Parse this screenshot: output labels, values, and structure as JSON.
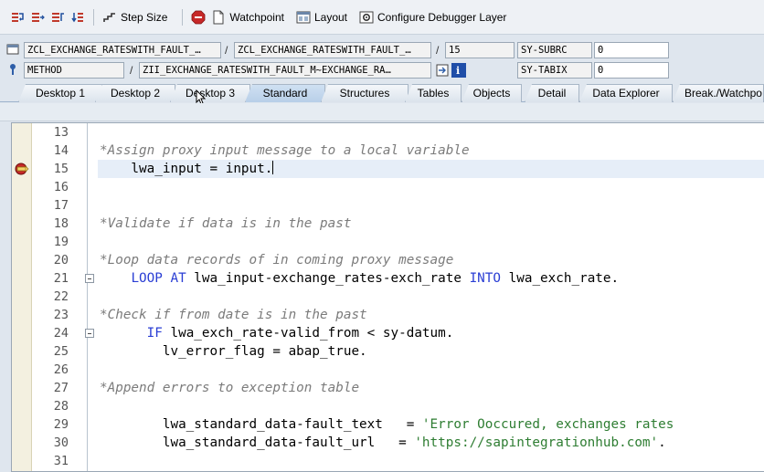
{
  "toolbar": {
    "step_size_label": "Step Size",
    "watchpoint_label": "Watchpoint",
    "layout_label": "Layout",
    "configure_label": "Configure Debugger Layer"
  },
  "context": {
    "row1": {
      "program": "ZCL_EXCHANGE_RATESWITH_FAULT_…",
      "include": "ZCL_EXCHANGE_RATESWITH_FAULT_…",
      "line": "15",
      "sysvar_name": "SY-SUBRC",
      "sysvar_value": "0"
    },
    "row2": {
      "event_type": "METHOD",
      "event": "ZII_EXCHANGE_RATESWITH_FAULT_M~EXCHANGE_RA…",
      "sysvar_name": "SY-TABIX",
      "sysvar_value": "0"
    },
    "separator": "/"
  },
  "tabs": [
    {
      "label": "Desktop 1"
    },
    {
      "label": "Desktop 2"
    },
    {
      "label": "Desktop 3"
    },
    {
      "label": "Standard"
    },
    {
      "label": "Structures"
    },
    {
      "label": "Tables"
    },
    {
      "label": "Objects"
    },
    {
      "label": "Detail"
    },
    {
      "label": "Data Explorer"
    },
    {
      "label": "Break./Watchpo"
    }
  ],
  "active_tab": "Standard",
  "editor": {
    "current_line": "15",
    "lines": [
      {
        "num": "13"
      },
      {
        "num": "14",
        "text": "*Assign proxy input message to a local variable"
      },
      {
        "num": "15",
        "text": "    lwa_input = input."
      },
      {
        "num": "16"
      },
      {
        "num": "17"
      },
      {
        "num": "18",
        "text": "*Validate if data is in the past"
      },
      {
        "num": "19"
      },
      {
        "num": "20",
        "text": "*Loop data records of in coming proxy message"
      },
      {
        "num": "21",
        "pre": "    ",
        "kw1": "LOOP AT",
        "mid": " lwa_input-exchange_rates-exch_rate ",
        "kw2": "INTO",
        "post": " lwa_exch_rate."
      },
      {
        "num": "22"
      },
      {
        "num": "23",
        "text": "*Check if from date is in the past"
      },
      {
        "num": "24",
        "pre": "      ",
        "kw1": "IF",
        "mid": " lwa_exch_rate-valid_from < sy-datum."
      },
      {
        "num": "25",
        "text": "        lv_error_flag = abap_true."
      },
      {
        "num": "26"
      },
      {
        "num": "27",
        "text": "*Append errors to exception table"
      },
      {
        "num": "28"
      },
      {
        "num": "29",
        "pre": "        lwa_standard_data-fault_text   = ",
        "str": "'Error Ooccured, exchanges rates"
      },
      {
        "num": "30",
        "pre": "        lwa_standard_data-fault_url   = ",
        "str": "'https://sapintegrationhub.com'",
        "post": "."
      },
      {
        "num": "31"
      }
    ]
  }
}
